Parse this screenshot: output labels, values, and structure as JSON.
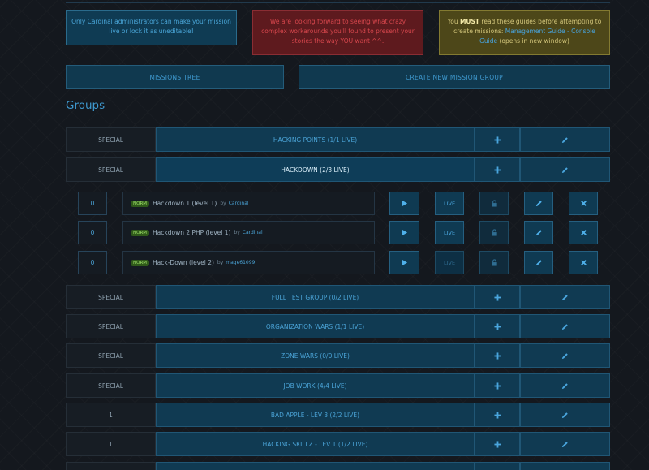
{
  "notices": {
    "admin": "Only Cardinal administrators can make your mission live or lock it as uneditable!",
    "warn": "We are looking forward to seeing what crazy complex workarounds you'll found to present your stories the way YOU want ^^.",
    "guide_prefix": "You ",
    "guide_must": "MUST",
    "guide_middle": " read these guides before attempting to create missions: ",
    "guide_link1": "Management Guide",
    "guide_sep": " - ",
    "guide_link2": "Console Guide",
    "guide_suffix": " (opens in new window)"
  },
  "buttons": {
    "missions_tree": "MISSIONS TREE",
    "create_group": "CREATE NEW MISSION GROUP"
  },
  "section_title": "Groups",
  "groups_before": [
    {
      "priority": "SPECIAL",
      "name": "HACKING POINTS (1/1 LIVE)"
    },
    {
      "priority": "SPECIAL",
      "name": "HACKDOWN (2/3 LIVE)"
    }
  ],
  "missions": [
    {
      "priority": "0",
      "tag": "NORM",
      "title": "Hackdown 1 (level 1)",
      "by": "by",
      "author": "Cardinal",
      "live": "LIVE"
    },
    {
      "priority": "0",
      "tag": "NORM",
      "title": "Hackdown 2 PHP (level 1)",
      "by": "by",
      "author": "Cardinal",
      "live": "LIVE"
    },
    {
      "priority": "0",
      "tag": "NORM",
      "title": "Hack-Down (level 2)",
      "by": "by",
      "author": "mage61099",
      "live": "LIVE"
    }
  ],
  "groups_after": [
    {
      "priority": "SPECIAL",
      "name": "FULL TEST GROUP (0/2 LIVE)"
    },
    {
      "priority": "SPECIAL",
      "name": "ORGANIZATION WARS (1/1 LIVE)"
    },
    {
      "priority": "SPECIAL",
      "name": "ZONE WARS (0/0 LIVE)"
    },
    {
      "priority": "SPECIAL",
      "name": "JOB WORK (4/4 LIVE)"
    },
    {
      "priority": "1",
      "name": "BAD APPLE - LEV 3 (2/2 LIVE)"
    },
    {
      "priority": "1",
      "name": "HACKING SKILLZ - LEV 1 (1/2 LIVE)"
    }
  ],
  "icons": {
    "add": "plus-icon",
    "edit": "pencil-icon",
    "play": "play-icon",
    "lock": "lock-icon",
    "delete": "close-icon"
  },
  "colors": {
    "background": "#14181e",
    "accent": "#3f9ad0",
    "notice_info": "#0f3b53",
    "notice_warn": "#5e1a1e",
    "notice_guide": "#4d4719",
    "norm_badge": "#2f5a1a"
  }
}
